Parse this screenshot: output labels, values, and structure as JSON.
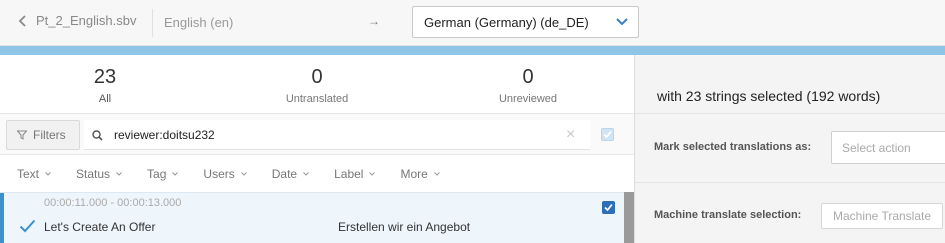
{
  "header": {
    "file_name": "Pt_2_English.sbv",
    "source_language": "English (en)",
    "arrow": "→",
    "target_language": "German (Germany) (de_DE)"
  },
  "stats": [
    {
      "count": "23",
      "label": "All"
    },
    {
      "count": "0",
      "label": "Untranslated"
    },
    {
      "count": "0",
      "label": "Unreviewed"
    }
  ],
  "filters": {
    "button_label": "Filters",
    "search_value": "reviewer:doitsu232",
    "clear_glyph": "×"
  },
  "columns": [
    "Text",
    "Status",
    "Tag",
    "Users",
    "Date",
    "Label",
    "More"
  ],
  "rows": [
    {
      "time_range": "00:00:11.000 - 00:00:13.000",
      "source": "Let's Create An Offer",
      "translation": "Erstellen wir ein Angebot",
      "selected": true
    }
  ],
  "side_panel": {
    "selection_summary": "with 23 strings selected (192 words)",
    "mark_label": "Mark selected translations as:",
    "action_placeholder": "Select action",
    "mt_label": "Machine translate selection:",
    "mt_button": "Machine Translate"
  },
  "colors": {
    "accent": "#3a91cc",
    "top_bar": "#8ec5e6",
    "checkbox": "#2d6fb7"
  }
}
